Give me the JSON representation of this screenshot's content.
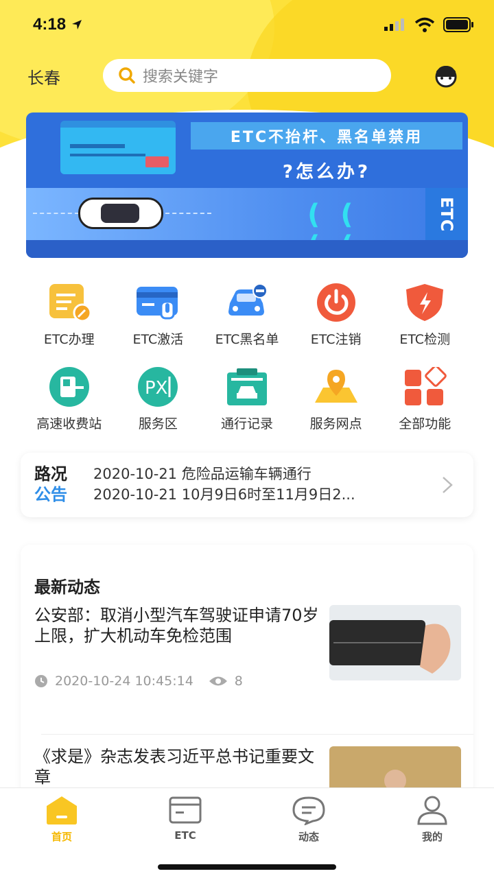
{
  "status_bar": {
    "time": "4:18"
  },
  "header": {
    "city": "长春",
    "search_placeholder": "搜索关键字"
  },
  "banner": {
    "title": "ETC不抬杆、黑名单禁用",
    "subtitle": "?怎么办?",
    "tag": "ETC"
  },
  "functions": [
    {
      "label": "ETC办理",
      "icon": "document-edit-icon"
    },
    {
      "label": "ETC激活",
      "icon": "card-touch-icon"
    },
    {
      "label": "ETC黑名单",
      "icon": "car-minus-icon"
    },
    {
      "label": "ETC注销",
      "icon": "power-icon"
    },
    {
      "label": "ETC检测",
      "icon": "shield-icon"
    },
    {
      "label": "高速收费站",
      "icon": "toll-booth-icon"
    },
    {
      "label": "服务区",
      "icon": "service-area-icon"
    },
    {
      "label": "通行记录",
      "icon": "travel-record-icon"
    },
    {
      "label": "服务网点",
      "icon": "location-pin-icon"
    },
    {
      "label": "全部功能",
      "icon": "all-functions-icon"
    }
  ],
  "notice": {
    "tag_line1": "路况",
    "tag_line2": "公告",
    "items": [
      "2020-10-21 危险品运输车辆通行",
      "2020-10-21 10月9日6时至11月9日2..."
    ]
  },
  "news": {
    "title": "最新动态",
    "articles": [
      {
        "title": "公安部：取消小型汽车驾驶证申请70岁上限，扩大机动车免检范围",
        "date": "2020-10-24 10:45:14",
        "views": "8"
      },
      {
        "title": "《求是》杂志发表习近平总书记重要文章"
      }
    ]
  },
  "tabs": [
    {
      "label": "首页",
      "active": true
    },
    {
      "label": "ETC"
    },
    {
      "label": "动态"
    },
    {
      "label": "我的"
    }
  ],
  "colors": {
    "accent": "#f5b800",
    "banner_blue": "#2f6fdc",
    "notice_blue": "#2f8ee8"
  }
}
